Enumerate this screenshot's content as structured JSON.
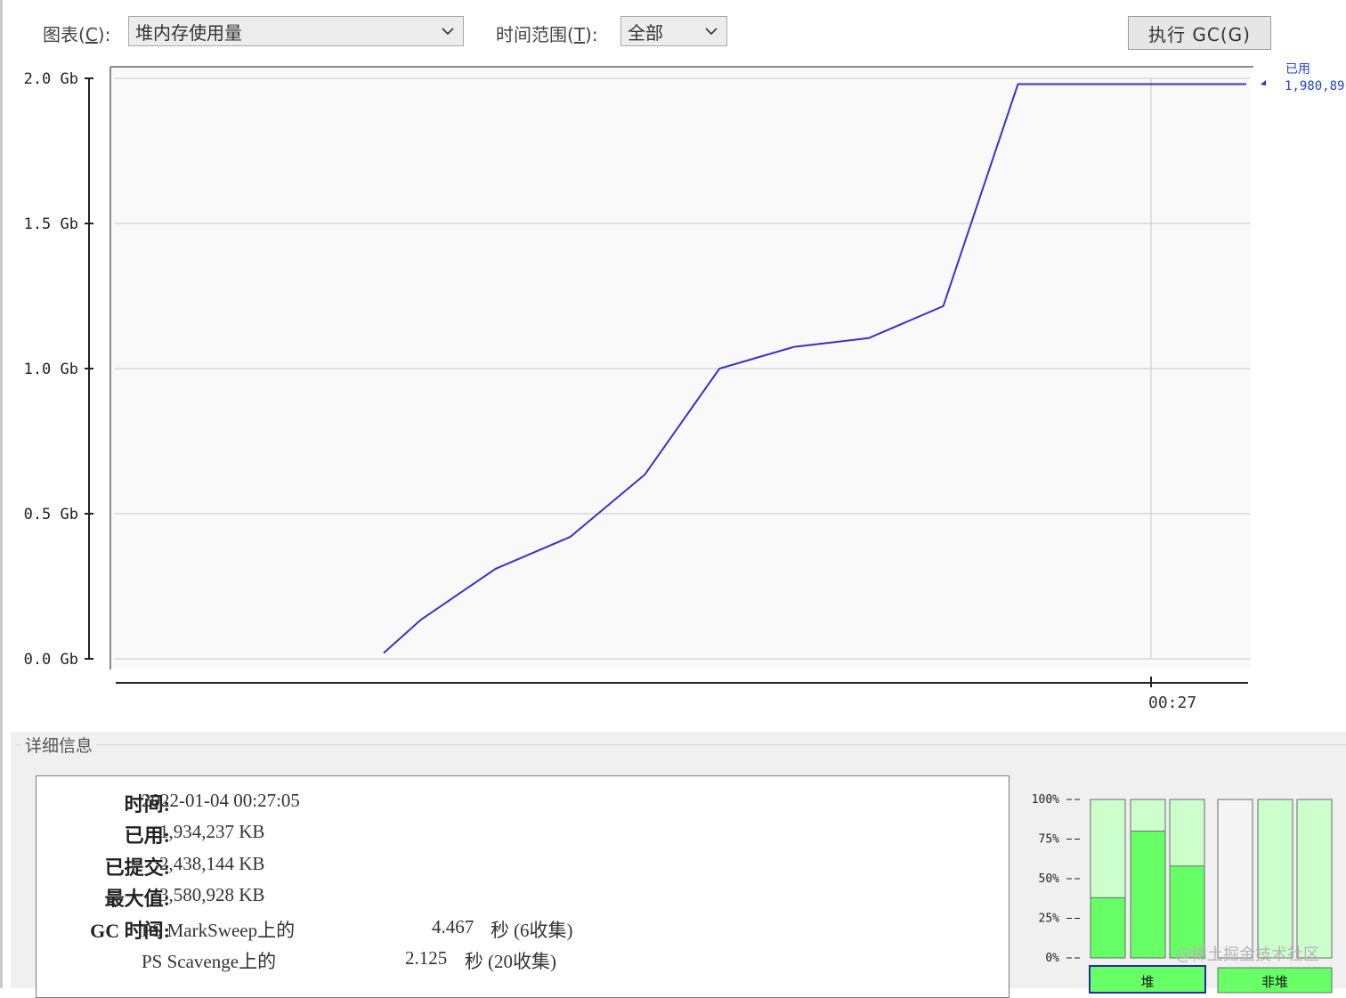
{
  "toolbar": {
    "chart_label": "图表(C):",
    "chart_mnemonic": "C",
    "chart_value": "堆内存使用量",
    "time_label": "时间范围(T):",
    "time_mnemonic": "T",
    "time_value": "全部",
    "gc_button": "执行 GC(G)"
  },
  "chart_data": {
    "type": "line",
    "y_ticks": [
      "2.0 Gb",
      "1.5 Gb",
      "1.0 Gb",
      "0.5 Gb",
      "0.0 Gb"
    ],
    "ylim": [
      0,
      2.0
    ],
    "x_tick": "00:27",
    "grid": true,
    "series": [
      {
        "name": "已用",
        "color": "#3333cc",
        "points": [
          {
            "x": 0.237,
            "y": 0.02
          },
          {
            "x": 0.27,
            "y": 0.135
          },
          {
            "x": 0.336,
            "y": 0.31
          },
          {
            "x": 0.402,
            "y": 0.42
          },
          {
            "x": 0.468,
            "y": 0.635
          },
          {
            "x": 0.534,
            "y": 1.0
          },
          {
            "x": 0.6,
            "y": 1.075
          },
          {
            "x": 0.666,
            "y": 1.105
          },
          {
            "x": 0.732,
            "y": 1.215
          },
          {
            "x": 0.798,
            "y": 1.98
          },
          {
            "x": 1.0,
            "y": 1.98
          }
        ]
      }
    ],
    "legend": {
      "name": "已用",
      "value": "1,980,89"
    }
  },
  "details": {
    "title": "详细信息",
    "time_label": "时间:",
    "time_value": "2022-01-04 00:27:05",
    "used_label": "已用:",
    "used_value": "1,934,237 KB",
    "committed_label": "已提交:",
    "committed_value": "2,438,144 KB",
    "max_label": "最大值:",
    "max_value": "3,580,928 KB",
    "gc_label": "GC 时间:",
    "gc_rows": [
      {
        "name": "PS MarkSweep上的",
        "time": "4.467",
        "unit": "秒",
        "count": "(6收集)"
      },
      {
        "name": "PS Scavenge上的",
        "time": "2.125",
        "unit": "秒",
        "count": "(20收集)"
      }
    ]
  },
  "pools": {
    "pct_labels": [
      "100%",
      "75%",
      "50%",
      "25%",
      "0%"
    ],
    "bars": [
      {
        "fill": 0.38,
        "kind": "heap"
      },
      {
        "fill": 0.8,
        "kind": "heap"
      },
      {
        "fill": 0.58,
        "kind": "heap"
      },
      {
        "fill": 0.0,
        "kind": "nonheap"
      },
      {
        "fill": 0.0,
        "kind": "nonheap"
      },
      {
        "fill": 0.0,
        "kind": "nonheap"
      }
    ],
    "heap_label": "堆",
    "nonheap_label": "非堆",
    "colors": {
      "fill": "#66ff66",
      "empty": "#ccffcc",
      "border": "#6a6a6a"
    }
  },
  "watermark": "@稀土掘金技术社区"
}
